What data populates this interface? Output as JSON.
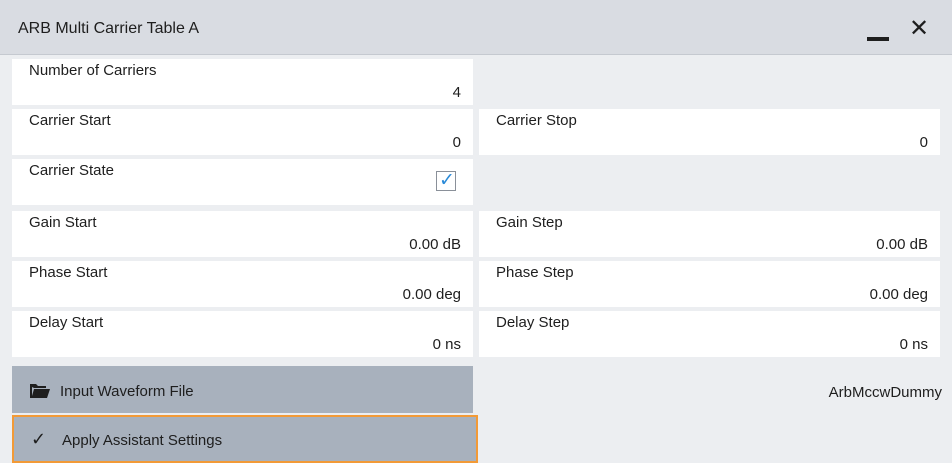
{
  "window": {
    "title": "ARB Multi Carrier Table A"
  },
  "fields": {
    "num_carriers": {
      "label": "Number of Carriers",
      "value": "4"
    },
    "carrier_start": {
      "label": "Carrier Start",
      "value": "0"
    },
    "carrier_stop": {
      "label": "Carrier Stop",
      "value": "0"
    },
    "carrier_state": {
      "label": "Carrier State",
      "checked": true
    },
    "gain_start": {
      "label": "Gain Start",
      "value": "0.00 dB"
    },
    "gain_step": {
      "label": "Gain Step",
      "value": "0.00 dB"
    },
    "phase_start": {
      "label": "Phase Start",
      "value": "0.00 deg"
    },
    "phase_step": {
      "label": "Phase Step",
      "value": "0.00 deg"
    },
    "delay_start": {
      "label": "Delay Start",
      "value": "0 ns"
    },
    "delay_step": {
      "label": "Delay Step",
      "value": "0 ns"
    }
  },
  "buttons": {
    "input_waveform": {
      "label": "Input Waveform File",
      "icon": "folder-icon"
    },
    "apply": {
      "label": "Apply Assistant Settings",
      "icon": "check-icon"
    }
  },
  "waveform_file": "ArbMccwDummy",
  "colors": {
    "titlebar": "#d9dce2",
    "button": "#a8b1bd",
    "focus": "#f29a37",
    "check": "#2a8ad8"
  }
}
